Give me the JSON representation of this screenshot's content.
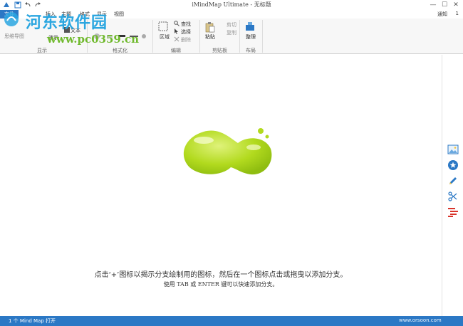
{
  "window": {
    "title": "iMindMap Ultimate - 无标题",
    "minimize": "—",
    "maximize": "☐",
    "close": "✕"
  },
  "tabs": {
    "file": "文件",
    "items": [
      "插入",
      "主题",
      "格式",
      "显示",
      "视图"
    ],
    "notify": "通知",
    "notify_count": "1"
  },
  "ribbon": {
    "display_group": "显示",
    "display_items": [
      "思维导图",
      "演示"
    ],
    "format_group": "格式化",
    "format_text": "文本",
    "edit_group": "编辑",
    "edit_area": "区域",
    "edit_find": "查找",
    "edit_select": "选择",
    "edit_delete": "删除",
    "clipboard_group": "剪贴板",
    "clipboard_paste": "粘贴",
    "clipboard_cut": "剪切",
    "clipboard_copy": "复制",
    "layout_group": "布局",
    "layout_arrange": "整理"
  },
  "watermark": {
    "title": "河东软件园",
    "url": "www.pc0359.cn",
    "corner": "www.orsoon.com"
  },
  "canvas": {
    "hint_main": "点击‘+’图标以揭示分支绘制用的图标，然后在一个图标点击或拖曳以添加分支。",
    "hint_sub": "使用 TAB 或 ENTER 键可以快速添加分支。"
  },
  "status": {
    "text": "1 个 Mind Map 打开"
  },
  "colors": {
    "accent": "#2b78c5",
    "blob": "#a9d61a"
  }
}
